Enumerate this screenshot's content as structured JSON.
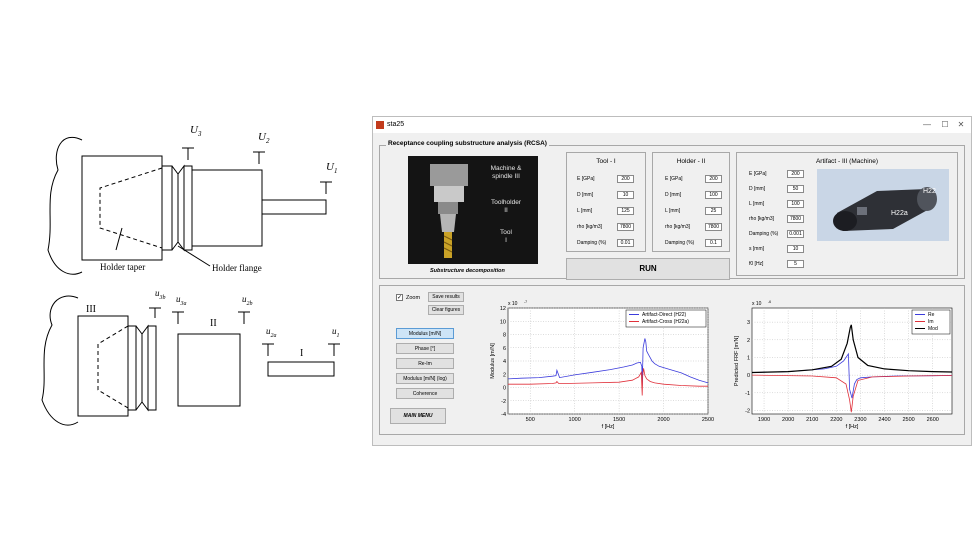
{
  "diagram": {
    "top_labels": {
      "u3": "U",
      "u3_sub": "3",
      "u2": "U",
      "u2_sub": "2",
      "u1": "U",
      "u1_sub": "1"
    },
    "holder_taper": "Holder taper",
    "holder_flange": "Holder flange",
    "bottom_labels": {
      "III": "III",
      "II": "II",
      "I": "I",
      "u3b": "u",
      "u3b_sub": "3b",
      "u3a": "u",
      "u3a_sub": "3a",
      "u2b": "u",
      "u2b_sub": "2b",
      "u2a": "u",
      "u2a_sub": "2a",
      "u1": "u",
      "u1_sub": "1"
    }
  },
  "window": {
    "title": "sta25",
    "controls": {
      "min": "—",
      "max": "☐",
      "close": "✕"
    },
    "group_title": "Receptance coupling substructure analysis (RCSA)",
    "image_overlay": {
      "machine": "Machine &",
      "spindle": "spindle III",
      "toolholder": "Toolholder",
      "toolholder_num": "II",
      "tool": "Tool",
      "tool_num": "I"
    },
    "image_caption": "Substructure decomposition",
    "tool_panel": {
      "title": "Tool - I",
      "fields": [
        {
          "label": "E [GPa]",
          "value": "200"
        },
        {
          "label": "D [mm]",
          "value": "10"
        },
        {
          "label": "L [mm]",
          "value": "125"
        },
        {
          "label": "rho [kg/m3]",
          "value": "7800"
        },
        {
          "label": "Damping (%)",
          "value": "0.01"
        }
      ]
    },
    "holder_panel": {
      "title": "Holder - II",
      "fields": [
        {
          "label": "E [GPa]",
          "value": "200"
        },
        {
          "label": "D [mm]",
          "value": "100"
        },
        {
          "label": "L [mm]",
          "value": "25"
        },
        {
          "label": "rho [kg/m3]",
          "value": "7800"
        },
        {
          "label": "Damping (%)",
          "value": "0.1"
        }
      ]
    },
    "artifact_panel": {
      "title": "Artifact - III (Machine)",
      "fields": [
        {
          "label": "E [GPa]",
          "value": "200"
        },
        {
          "label": "D [mm]",
          "value": "50"
        },
        {
          "label": "L [mm]",
          "value": "100"
        },
        {
          "label": "rho [kg/m3]",
          "value": "7800"
        },
        {
          "label": "Damping (%)",
          "value": "0.001"
        },
        {
          "label": "s [mm]",
          "value": "10"
        },
        {
          "label": "f0 [Hz]",
          "value": "5"
        }
      ],
      "image_labels": {
        "h22": "H22",
        "h22a": "H22a"
      }
    },
    "run_label": "RUN",
    "zoom_label": "Zoom",
    "zoom_checked": "✓",
    "save_results": "Save results",
    "clear_figures": "Clear figures",
    "plot_buttons": [
      "Modulus [m/N]",
      "Phase [°]",
      "Re-Im",
      "Modulus [m/N] (log)",
      "Coherence"
    ],
    "main_menu": "MAIN MENU"
  },
  "chart_data": [
    {
      "type": "line",
      "exponent": "x 10",
      "exponent_power": "-7",
      "xlabel": "f [Hz]",
      "ylabel": "Modulus [m/N]",
      "xlim": [
        250,
        2500
      ],
      "ylim": [
        -4,
        12
      ],
      "xticks": [
        500,
        1000,
        1500,
        2000,
        2500
      ],
      "yticks": [
        -4,
        -2,
        0,
        2,
        4,
        6,
        8,
        10,
        12
      ],
      "ytick_labels": [
        "-4",
        "-2",
        "0",
        "2",
        "4",
        "6",
        "8",
        "10",
        "12"
      ],
      "grid": true,
      "legend_position": "top-right",
      "series": [
        {
          "name": "Artifact-Direct (H22)",
          "color": "#3c3cdc",
          "x": [
            250,
            400,
            600,
            750,
            790,
            800,
            830,
            1000,
            1200,
            1400,
            1550,
            1650,
            1700,
            1740,
            1755,
            1760,
            1770,
            1790,
            1800,
            1810,
            1830,
            1850,
            1870,
            1900,
            1950,
            2000,
            2100,
            2200,
            2300,
            2400,
            2500
          ],
          "y": [
            1.3,
            1.4,
            1.5,
            1.7,
            1.8,
            2.6,
            1.5,
            1.9,
            2.3,
            2.7,
            3.1,
            3.4,
            3.7,
            3.8,
            3.2,
            0.2,
            6.0,
            7.4,
            6.9,
            5.5,
            5.0,
            4.5,
            4.0,
            3.6,
            3.2,
            3.0,
            2.6,
            2.2,
            1.6,
            1.1,
            0.7
          ]
        },
        {
          "name": "Artifact-Cross (H22a)",
          "color": "#e0303a",
          "x": [
            250,
            500,
            750,
            790,
            800,
            820,
            900,
            1200,
            1500,
            1650,
            1720,
            1750,
            1760,
            1765,
            1775,
            1790,
            1810,
            1850,
            1900,
            2000,
            2200,
            2400,
            2500
          ],
          "y": [
            0.5,
            0.5,
            0.6,
            0.7,
            0.9,
            0.6,
            0.6,
            0.7,
            0.8,
            1.1,
            1.6,
            2.3,
            -1.2,
            1.8,
            2.9,
            1.8,
            1.3,
            0.9,
            0.7,
            0.5,
            0.3,
            0.2,
            0.2
          ]
        }
      ]
    },
    {
      "type": "line",
      "exponent": "x 10",
      "exponent_power": "-6",
      "xlabel": "f [Hz]",
      "ylabel": "Predicted FRF [m/N]",
      "xlim": [
        1850,
        2680
      ],
      "ylim": [
        -2.2,
        3.8
      ],
      "xticks": [
        1900,
        2000,
        2100,
        2200,
        2300,
        2400,
        2500,
        2600
      ],
      "yticks": [
        -2,
        -1,
        0,
        1,
        2,
        3
      ],
      "ytick_labels": [
        "-2",
        "-1",
        "0",
        "1",
        "2",
        "3"
      ],
      "grid": true,
      "legend_position": "top-right",
      "series": [
        {
          "name": "Re",
          "color": "#3c3cdc",
          "x": [
            1850,
            2000,
            2150,
            2200,
            2230,
            2250,
            2255,
            2265,
            2275,
            2285,
            2300,
            2350,
            2450,
            2600,
            2680
          ],
          "y": [
            0.15,
            0.2,
            0.35,
            0.5,
            0.8,
            1.2,
            -0.8,
            -1.3,
            -0.5,
            -0.25,
            -0.15,
            -0.1,
            -0.05,
            -0.03,
            -0.02
          ]
        },
        {
          "name": "Im",
          "color": "#e0303a",
          "x": [
            1850,
            2100,
            2200,
            2240,
            2255,
            2262,
            2270,
            2290,
            2350,
            2500,
            2680
          ],
          "y": [
            0.0,
            -0.05,
            -0.15,
            -0.5,
            -1.4,
            -2.1,
            -1.2,
            -0.3,
            -0.1,
            -0.05,
            -0.02
          ]
        },
        {
          "name": "Mod",
          "color": "#000000",
          "x": [
            1850,
            2000,
            2100,
            2180,
            2220,
            2245,
            2258,
            2262,
            2270,
            2290,
            2330,
            2400,
            2500,
            2600,
            2680
          ],
          "y": [
            0.15,
            0.2,
            0.3,
            0.5,
            0.9,
            1.8,
            2.7,
            2.85,
            2.0,
            1.0,
            0.55,
            0.35,
            0.25,
            0.2,
            0.18
          ]
        }
      ]
    }
  ]
}
